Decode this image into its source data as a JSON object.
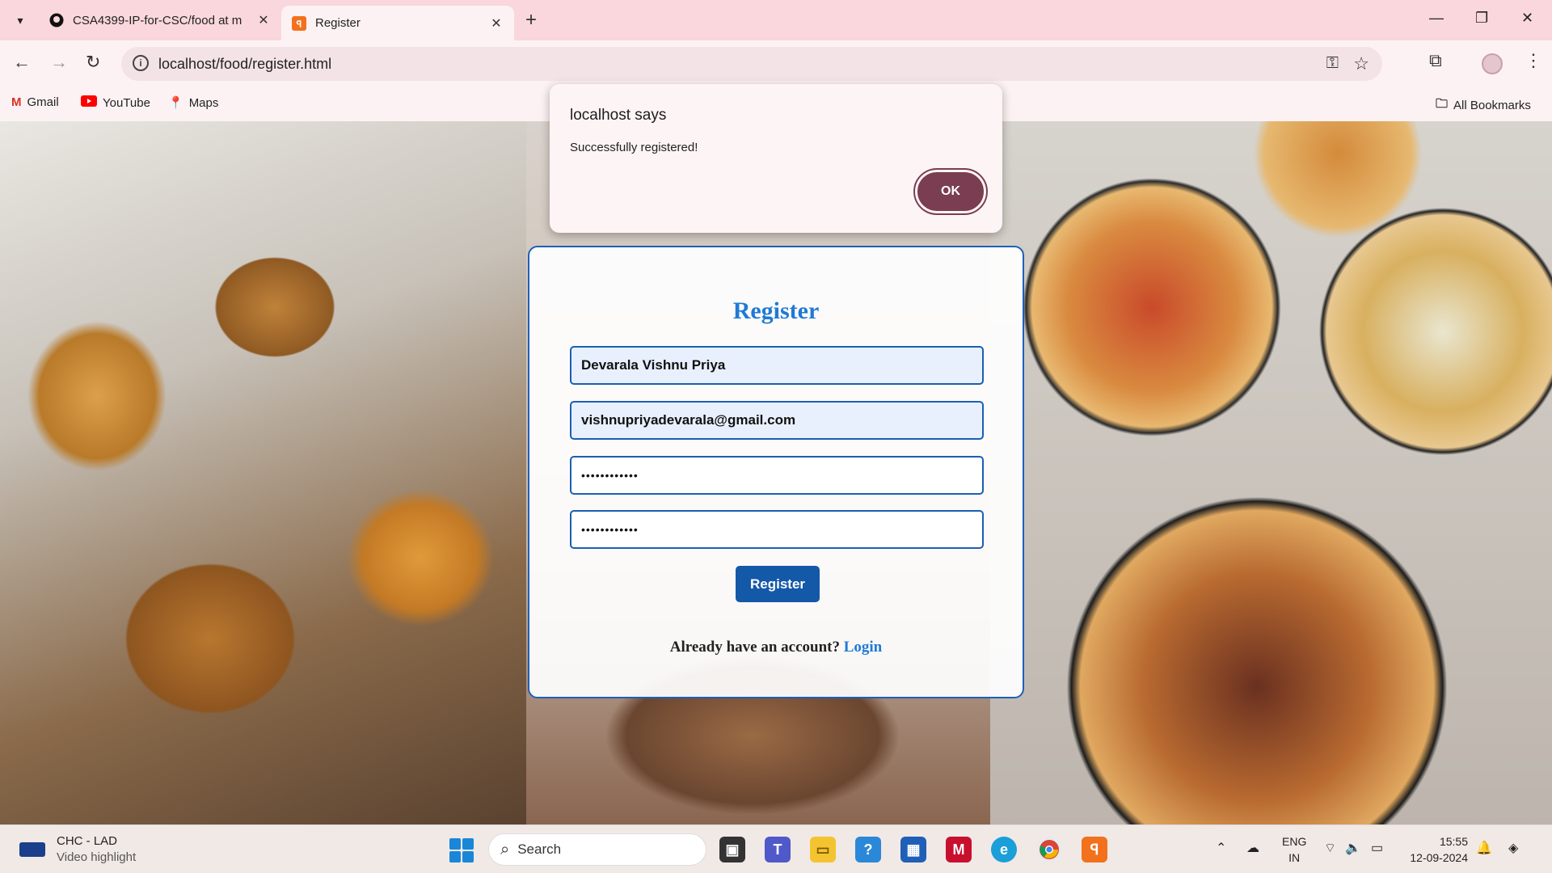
{
  "browser": {
    "tabs": [
      {
        "title": "CSA4399-IP-for-CSC/food at m",
        "active": false,
        "icon": "github-icon"
      },
      {
        "title": "Register",
        "active": true,
        "icon": "xampp-icon"
      }
    ],
    "url": "localhost/food/register.html",
    "bookmarks": [
      {
        "label": "Gmail",
        "icon": "gmail-icon"
      },
      {
        "label": "YouTube",
        "icon": "youtube-icon"
      },
      {
        "label": "Maps",
        "icon": "maps-icon"
      }
    ],
    "all_bookmarks": "All Bookmarks"
  },
  "dialog": {
    "title": "localhost says",
    "message": "Successfully registered!",
    "ok_label": "OK"
  },
  "form": {
    "title": "Register",
    "name_value": "Devarala Vishnu Priya",
    "email_value": "vishnupriyadevarala@gmail.com",
    "password_mask": "••••••••••••",
    "confirm_mask": "••••••••••••",
    "submit_label": "Register",
    "login_prompt": "Already have an account?",
    "login_link": "Login"
  },
  "taskbar": {
    "weather_title": "CHC - LAD",
    "weather_sub": "Video highlight",
    "search_placeholder": "Search",
    "lang_top": "ENG",
    "lang_bottom": "IN",
    "time": "15:55",
    "date": "12-09-2024"
  },
  "colors": {
    "tabstrip": "#f9d7dc",
    "accent_blue": "#1f7ad6",
    "button_blue": "#1458a8",
    "dialog_ok": "#7a3d52"
  }
}
